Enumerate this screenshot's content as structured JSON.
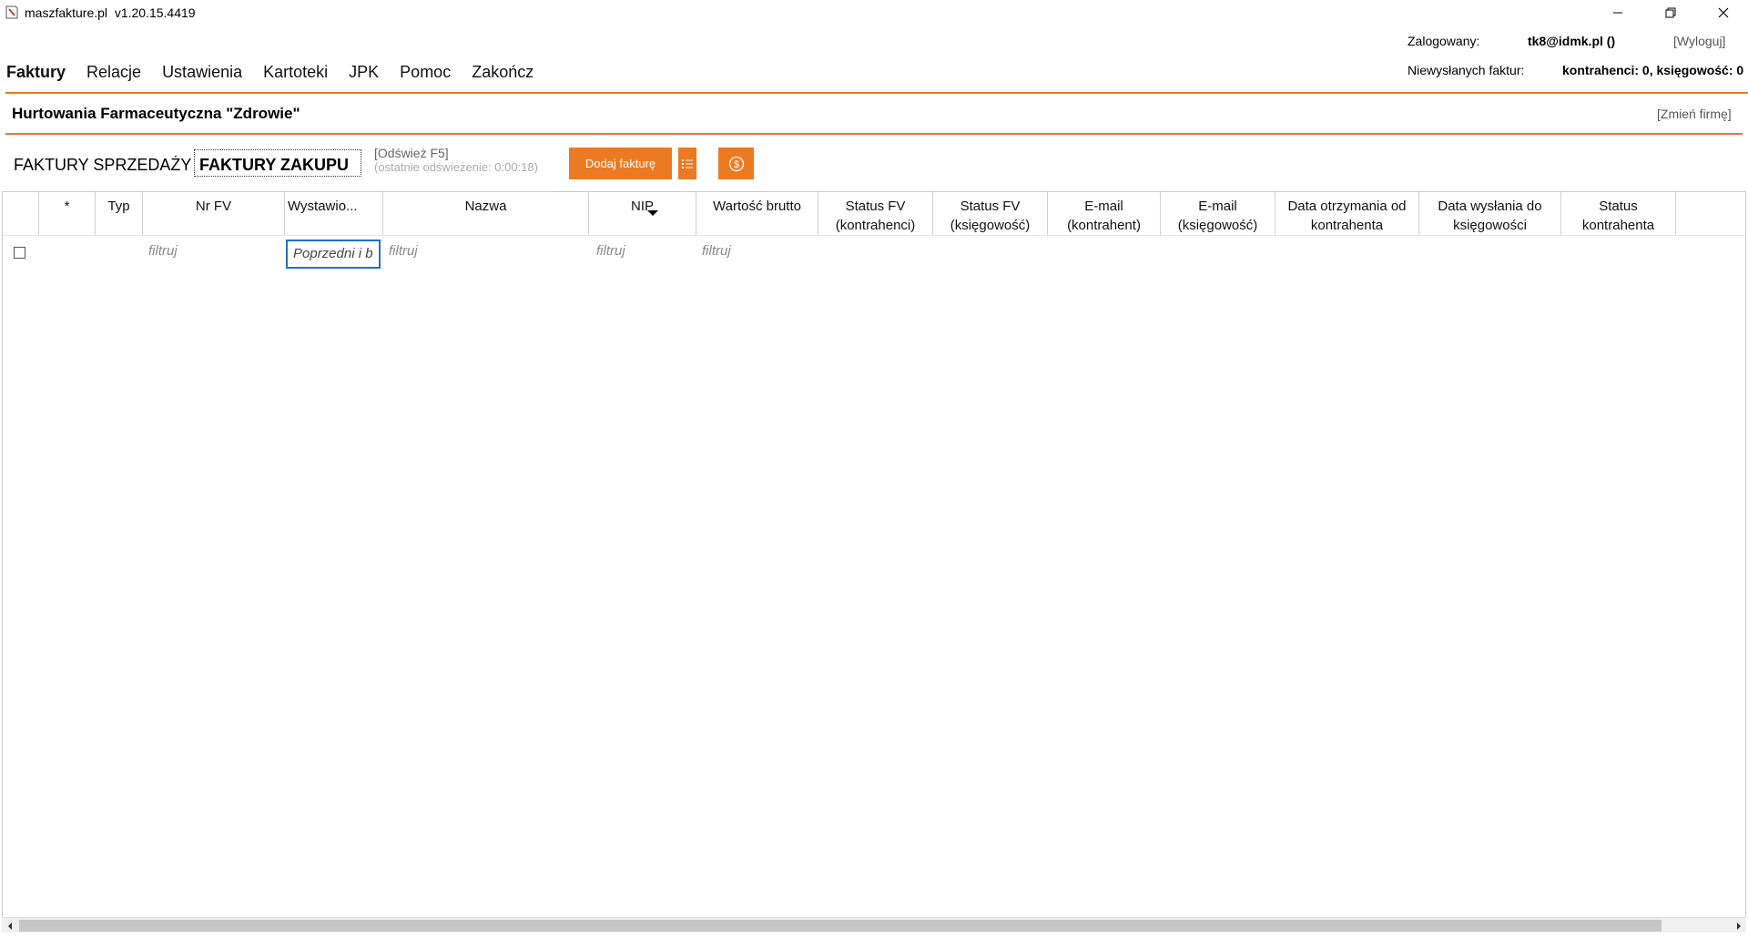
{
  "window": {
    "title": "maszfakture.pl  v1.20.15.4419",
    "minimize_glyph": "—",
    "maximize_glyph": "❐",
    "close_glyph": "✕"
  },
  "header": {
    "logged_label": "Zalogowany:",
    "logged_user": "tk8@idmk.pl ()",
    "logout": "[Wyloguj]",
    "unsent_label": "Niewysłanych faktur:",
    "unsent_value": "kontrahenci: 0, księgowość: 0"
  },
  "menu": {
    "items": [
      {
        "label": "Faktury"
      },
      {
        "label": "Relacje"
      },
      {
        "label": "Ustawienia"
      },
      {
        "label": "Kartoteki"
      },
      {
        "label": "JPK"
      },
      {
        "label": "Pomoc"
      },
      {
        "label": "Zakończ"
      }
    ]
  },
  "company": {
    "name": "Hurtowania Farmaceutyczna \"Zdrowie\"",
    "change": "[Zmień firmę]"
  },
  "toolbar": {
    "tab_sales": "FAKTURY SPRZEDAŻY",
    "tab_purchase": "FAKTURY ZAKUPU",
    "refresh": "[Odśwież F5]",
    "last_refresh": "(ostatnie odświeżenie: 0:00:18)",
    "add_invoice": "Dodaj fakturę"
  },
  "grid": {
    "columns": [
      {
        "label": "*"
      },
      {
        "label": "Typ"
      },
      {
        "label": "Nr FV"
      },
      {
        "label": "Wystawio..."
      },
      {
        "label": "Nazwa"
      },
      {
        "label": "NIP"
      },
      {
        "label": "Wartość brutto"
      },
      {
        "label": "Status FV (kontrahenci)"
      },
      {
        "label": "Status FV (księgowość)"
      },
      {
        "label": "E-mail (kontrahent)"
      },
      {
        "label": "E-mail (księgowość)"
      },
      {
        "label": "Data otrzymania od kontrahenta"
      },
      {
        "label": "Data wysłania do księgowości"
      },
      {
        "label": "Status kontrahenta"
      }
    ],
    "filter_placeholder": "filtruj",
    "date_filter_value": "Poprzedni i b"
  },
  "colors": {
    "accent": "#ec7a22",
    "focus": "#1e6fd0"
  }
}
